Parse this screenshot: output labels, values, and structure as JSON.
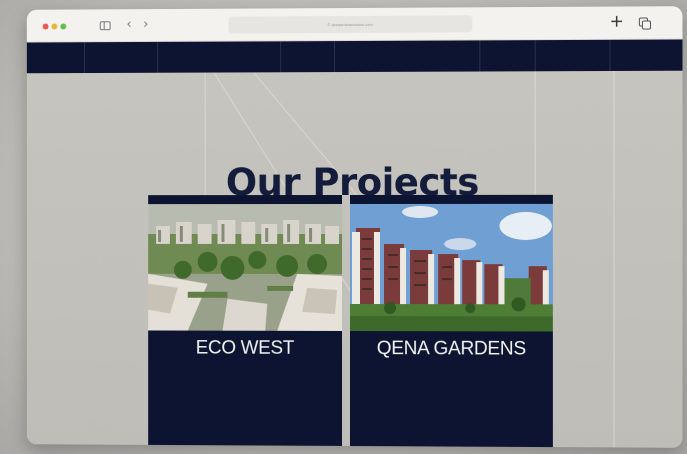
{
  "browser": {
    "url_text": "© qenaandzanadovs.com",
    "controls": {
      "close_color": "#ec5a53",
      "minimize_color": "#e6b73c",
      "maximize_color": "#5fbf49"
    },
    "new_tab_symbol": "+",
    "back_symbol": "‹",
    "forward_symbol": "›"
  },
  "page": {
    "title": "Our Projects",
    "navbar_color": "#0c1431"
  },
  "projects": [
    {
      "name": "ECO WEST",
      "image": "aerial-residential-compound"
    },
    {
      "name": "QENA GARDENS",
      "image": "apartment-towers-blue-sky"
    }
  ]
}
